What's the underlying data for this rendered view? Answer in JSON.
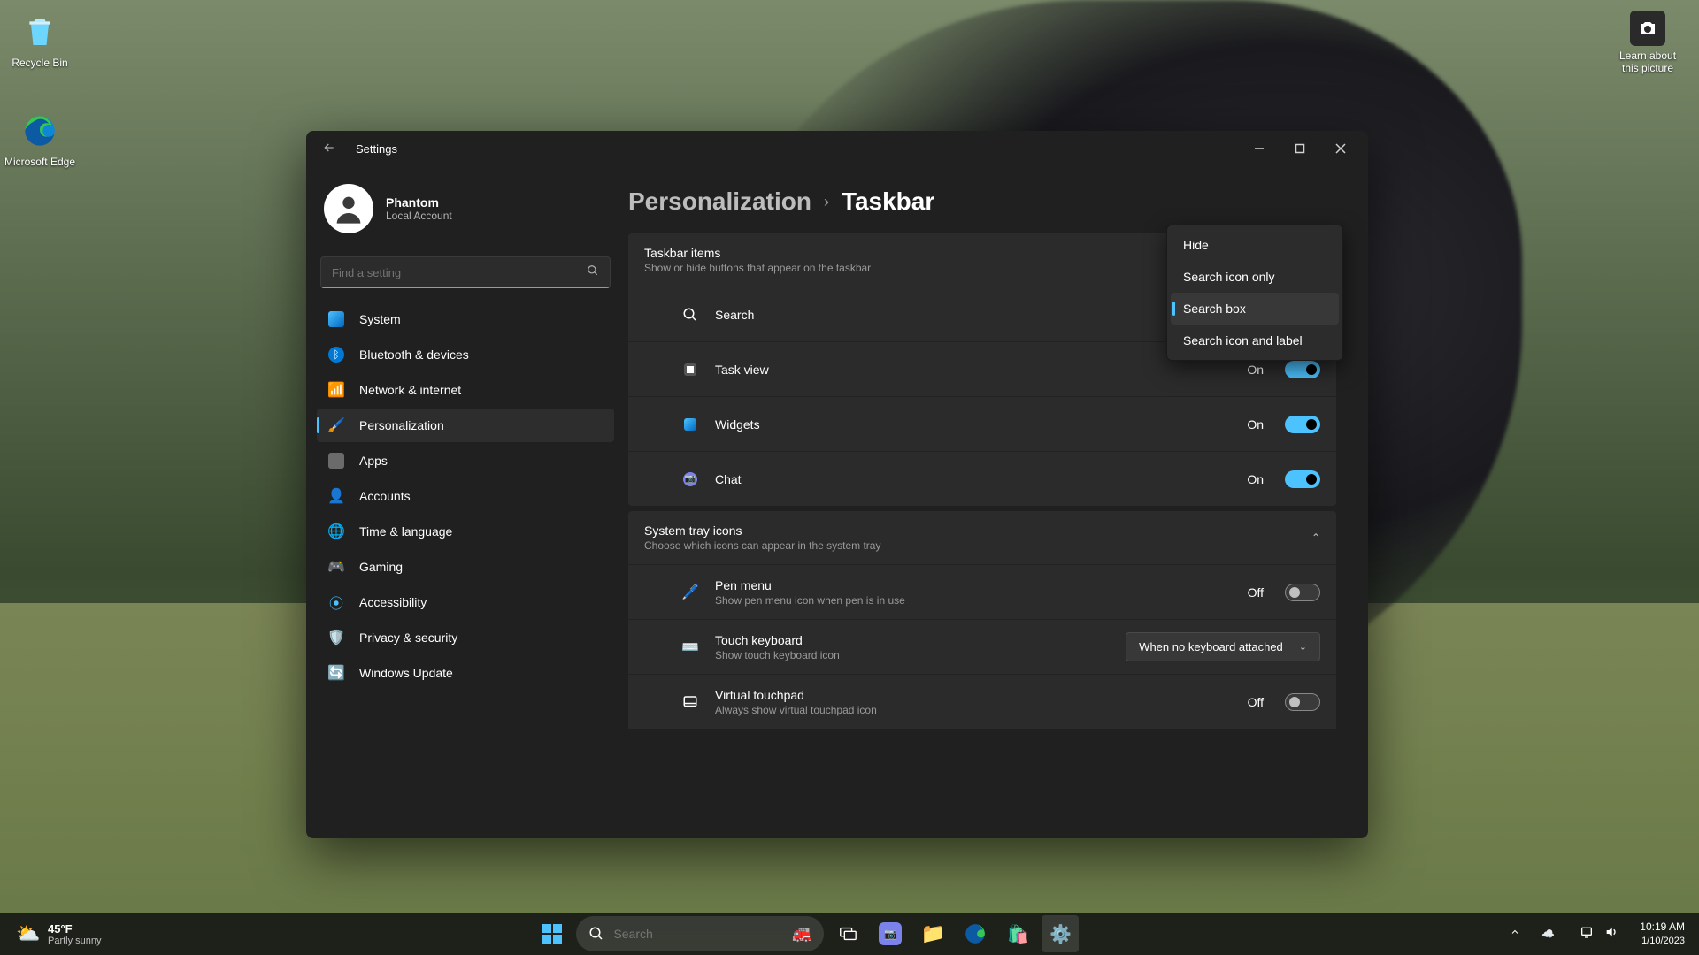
{
  "desktop": {
    "icons": {
      "recycle_bin": "Recycle Bin",
      "edge": "Microsoft Edge",
      "spotlight_line1": "Learn about",
      "spotlight_line2": "this picture"
    }
  },
  "window": {
    "title": "Settings",
    "breadcrumb_parent": "Personalization",
    "breadcrumb_current": "Taskbar"
  },
  "user": {
    "name": "Phantom",
    "account": "Local Account"
  },
  "search": {
    "placeholder": "Find a setting"
  },
  "nav": {
    "system": "System",
    "bluetooth": "Bluetooth & devices",
    "network": "Network & internet",
    "personalization": "Personalization",
    "apps": "Apps",
    "accounts": "Accounts",
    "time": "Time & language",
    "gaming": "Gaming",
    "accessibility": "Accessibility",
    "privacy": "Privacy & security",
    "update": "Windows Update"
  },
  "groups": {
    "taskbar_items": {
      "title": "Taskbar items",
      "desc": "Show or hide buttons that appear on the taskbar"
    },
    "system_tray": {
      "title": "System tray icons",
      "desc": "Choose which icons can appear in the system tray"
    }
  },
  "rows": {
    "search": {
      "label": "Search"
    },
    "task_view": {
      "label": "Task view",
      "state": "On"
    },
    "widgets": {
      "label": "Widgets",
      "state": "On"
    },
    "chat": {
      "label": "Chat",
      "state": "On"
    },
    "pen": {
      "label": "Pen menu",
      "sub": "Show pen menu icon when pen is in use",
      "state": "Off"
    },
    "touch_kb": {
      "label": "Touch keyboard",
      "sub": "Show touch keyboard icon",
      "dropdown": "When no keyboard attached"
    },
    "touchpad": {
      "label": "Virtual touchpad",
      "sub": "Always show virtual touchpad icon",
      "state": "Off"
    }
  },
  "search_dropdown": {
    "hide": "Hide",
    "icon_only": "Search icon only",
    "box": "Search box",
    "icon_label": "Search icon and label"
  },
  "taskbar": {
    "weather_temp": "45°F",
    "weather_cond": "Partly sunny",
    "search_placeholder": "Search",
    "time": "10:19 AM",
    "date": "1/10/2023"
  }
}
